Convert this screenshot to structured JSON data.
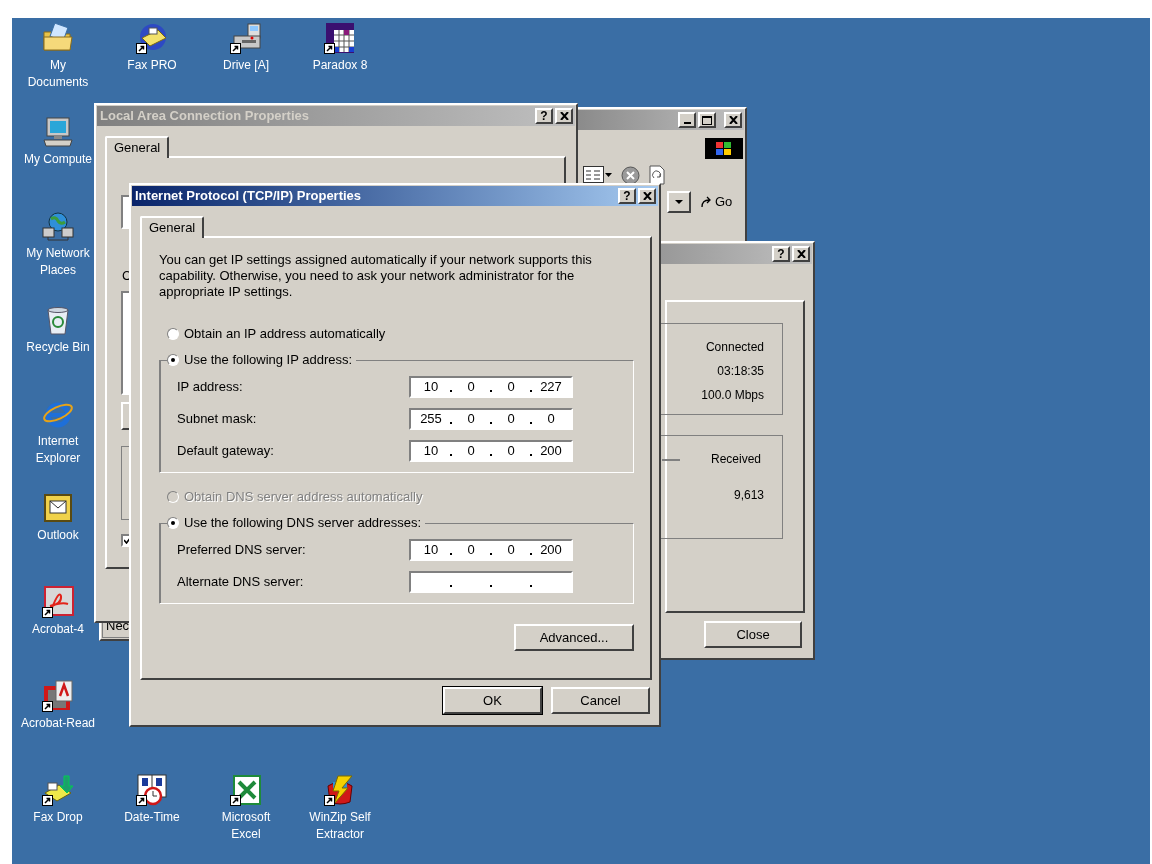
{
  "desktop_icons": [
    {
      "label": "My Documents",
      "kind": "documents",
      "shortcut": false
    },
    {
      "label": "Fax PRO",
      "kind": "fax",
      "shortcut": true
    },
    {
      "label": "Drive [A]",
      "kind": "floppy",
      "shortcut": true
    },
    {
      "label": "Paradox 8",
      "kind": "grid",
      "shortcut": true
    },
    {
      "label": "My Compute",
      "kind": "computer",
      "shortcut": false
    },
    {
      "label": "My Network Places",
      "kind": "network",
      "shortcut": false
    },
    {
      "label": "Recycle Bin",
      "kind": "recycle",
      "shortcut": false
    },
    {
      "label": "Internet Explorer",
      "kind": "ie",
      "shortcut": false
    },
    {
      "label": "Outlook",
      "kind": "outlook",
      "shortcut": false
    },
    {
      "label": "Acrobat-4",
      "kind": "acrobat",
      "shortcut": true
    },
    {
      "label": "Acrobat-Read",
      "kind": "reader",
      "shortcut": true
    },
    {
      "label": "Fax Drop",
      "kind": "faxdrop",
      "shortcut": true
    },
    {
      "label": "Date-Time",
      "kind": "calendar",
      "shortcut": true
    },
    {
      "label": "Microsoft Excel",
      "kind": "excel",
      "shortcut": true
    },
    {
      "label": "WinZip Self Extractor",
      "kind": "winzip",
      "shortcut": true
    }
  ],
  "browser_window": {
    "active": false,
    "go_button": "Go"
  },
  "status_window": {
    "active": false,
    "help_button": "?",
    "status": "Connected",
    "duration": "03:18:35",
    "speed": "100.0 Mbps",
    "received_label": "Received",
    "received_bytes": "9,613",
    "close_button": "Close"
  },
  "background_window": {
    "partial_text": "Nec"
  },
  "lan_window": {
    "title": "Local Area Connection Properties",
    "active": false,
    "help_button": "?",
    "tabs": [
      {
        "label": "General",
        "selected": true
      }
    ],
    "partial_label": "C",
    "checkbox_checked": true
  },
  "tcpip_dialog": {
    "title": "Internet Protocol (TCP/IP) Properties",
    "active": true,
    "help_button": "?",
    "tabs": [
      {
        "label": "General",
        "selected": true
      }
    ],
    "intro": "You can get IP settings assigned automatically if your network supports this capability. Otherwise, you need to ask your network administrator for the appropriate IP settings.",
    "ip_auto": {
      "label": "Obtain an IP address automatically",
      "selected": false,
      "disabled": false
    },
    "ip_manual": {
      "label": "Use the following IP address:",
      "selected": true,
      "disabled": false,
      "fields": [
        {
          "label": "IP address:",
          "octets": [
            "10",
            "0",
            "0",
            "227"
          ]
        },
        {
          "label": "Subnet mask:",
          "octets": [
            "255",
            "0",
            "0",
            "0"
          ]
        },
        {
          "label": "Default gateway:",
          "octets": [
            "10",
            "0",
            "0",
            "200"
          ]
        }
      ]
    },
    "dns_auto": {
      "label": "Obtain DNS server address automatically",
      "selected": false,
      "disabled": true
    },
    "dns_manual": {
      "label": "Use the following DNS server addresses:",
      "selected": true,
      "disabled": false,
      "fields": [
        {
          "label": "Preferred DNS server:",
          "octets": [
            "10",
            "0",
            "0",
            "200"
          ]
        },
        {
          "label": "Alternate DNS server:"
        }
      ]
    },
    "advanced_button": "Advanced...",
    "buttons": [
      {
        "label": "OK",
        "default": true
      },
      {
        "label": "Cancel",
        "default": false
      }
    ]
  }
}
